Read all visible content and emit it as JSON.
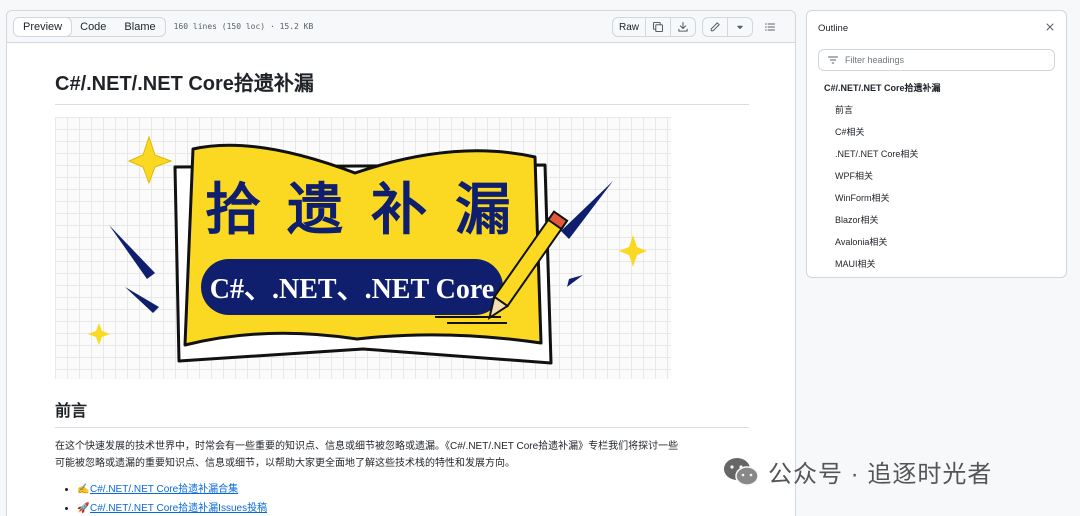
{
  "header": {
    "view_tabs": [
      "Preview",
      "Code",
      "Blame"
    ],
    "file_meta": "160 lines (150 loc) · 15.2 KB",
    "raw_label": "Raw"
  },
  "content": {
    "h1": "C#/.NET/.NET Core拾遗补漏",
    "banner": {
      "title_chars": [
        "拾",
        "遗",
        "补",
        "漏"
      ],
      "subtitle": "C#、.NET、.NET Core"
    },
    "h2": "前言",
    "intro_line1": "在这个快速发展的技术世界中，时常会有一些重要的知识点、信息或细节被忽略或遗漏。《C#/.NET/.NET Core拾遗补漏》专栏我们将探讨一些",
    "intro_line2": "可能被忽略或遗漏的重要知识点、信息或细节，以帮助大家更全面地了解这些技术栈的特性和发展方向。",
    "links": [
      {
        "emoji": "✍️",
        "text": "C#/.NET/.NET Core拾遗补漏合集"
      },
      {
        "emoji": "🚀",
        "text": "C#/.NET/.NET Core拾遗补漏Issues投稿"
      }
    ]
  },
  "outline": {
    "title": "Outline",
    "filter_placeholder": "Filter headings",
    "items": [
      {
        "label": "C#/.NET/.NET Core拾遗补漏",
        "level": 1
      },
      {
        "label": "前言",
        "level": 2
      },
      {
        "label": "C#相关",
        "level": 2
      },
      {
        "label": ".NET/.NET Core相关",
        "level": 2
      },
      {
        "label": "WPF相关",
        "level": 2
      },
      {
        "label": "WinForm相关",
        "level": 2
      },
      {
        "label": "Blazor相关",
        "level": 2
      },
      {
        "label": "Avalonia相关",
        "level": 2
      },
      {
        "label": "MAUI相关",
        "level": 2
      }
    ]
  },
  "watermark": {
    "text": "公众号 · 追逐时光者"
  },
  "colors": {
    "banner_yellow": "#fbd923",
    "banner_navy": "#0f1f6e",
    "link_blue": "#0969da"
  }
}
